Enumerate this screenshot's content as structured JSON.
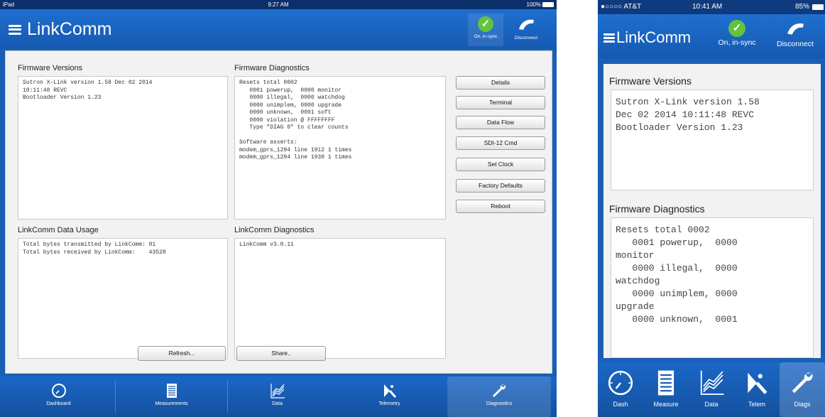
{
  "ipad": {
    "status": {
      "carrier": "iPad",
      "time": "9:27 AM",
      "battery": "100%"
    },
    "app_title": "LinkComm",
    "nav": {
      "sync_label": "On, in-sync",
      "disconnect_label": "Disconnect"
    },
    "sections": {
      "firmware_versions": {
        "title": "Firmware Versions",
        "text": "Sutron X-Link version 1.58 Dec 02 2014\n10:11:48 REVC\nBootloader Version 1.23"
      },
      "firmware_diagnostics": {
        "title": "Firmware Diagnostics",
        "text": "Resets total 0002\n   0001 powerup,  0000 monitor\n   0000 illegal,  0000 watchdog\n   0000 unimplem, 0000 upgrade\n   0000 unknown,  0001 soft\n   0000 violation @ FFFFFFFF\n   Type \"DIAG 0\" to clear counts\n\nSoftware asserts:\nmodem_gprs_1294 line 1912 1 times\nmodem_gprs_1294 line 1930 1 times"
      },
      "data_usage": {
        "title": "LinkComm Data Usage",
        "text": "Total bytes transmitted by LinkComm: 81\nTotal bytes received by LinkComm:    43528"
      },
      "linkcomm_diagnostics": {
        "title": "LinkComm Diagnostics",
        "text": "LinkComm v3.0.11"
      }
    },
    "side_buttons": [
      "Details",
      "Terminal",
      "Data Flow",
      "SDI-12 Cmd",
      "Set Clock",
      "Factory Defaults",
      "Reboot"
    ],
    "bottom_buttons": {
      "refresh": "Refresh...",
      "share": "Share.."
    },
    "tabs": [
      "Dashboard",
      "Measurements",
      "Data",
      "Telemetry",
      "Diagnostics"
    ],
    "active_tab": "Diagnostics"
  },
  "phone": {
    "status": {
      "carrier": "●○○○○ AT&T",
      "time": "10:41 AM",
      "battery": "85%"
    },
    "app_title": "LinkComm",
    "nav": {
      "sync_label": "On, in-sync",
      "disconnect_label": "Disconnect"
    },
    "firmware_versions": {
      "title": "Firmware Versions",
      "text": "Sutron X-Link version 1.58\nDec 02 2014 10:11:48 REVC\nBootloader Version 1.23"
    },
    "firmware_diagnostics": {
      "title": "Firmware Diagnostics",
      "text": "Resets total 0002\n   0001 powerup,  0000\nmonitor\n   0000 illegal,  0000\nwatchdog\n   0000 unimplem, 0000\nupgrade\n   0000 unknown,  0001"
    },
    "tabs": [
      "Dash",
      "Measure",
      "Data",
      "Telem",
      "Diags"
    ],
    "active_tab": "Diags"
  },
  "colors": {
    "brand_blue": "#1b5fb4",
    "sync_green": "#62c43c",
    "panel_bg": "#f2f2f2"
  },
  "icons": [
    "menu-icon",
    "check-circle-icon",
    "phone-handset-icon",
    "gauge-icon",
    "list-icon",
    "chart-lines-icon",
    "satellite-dish-icon",
    "wrench-icon"
  ]
}
